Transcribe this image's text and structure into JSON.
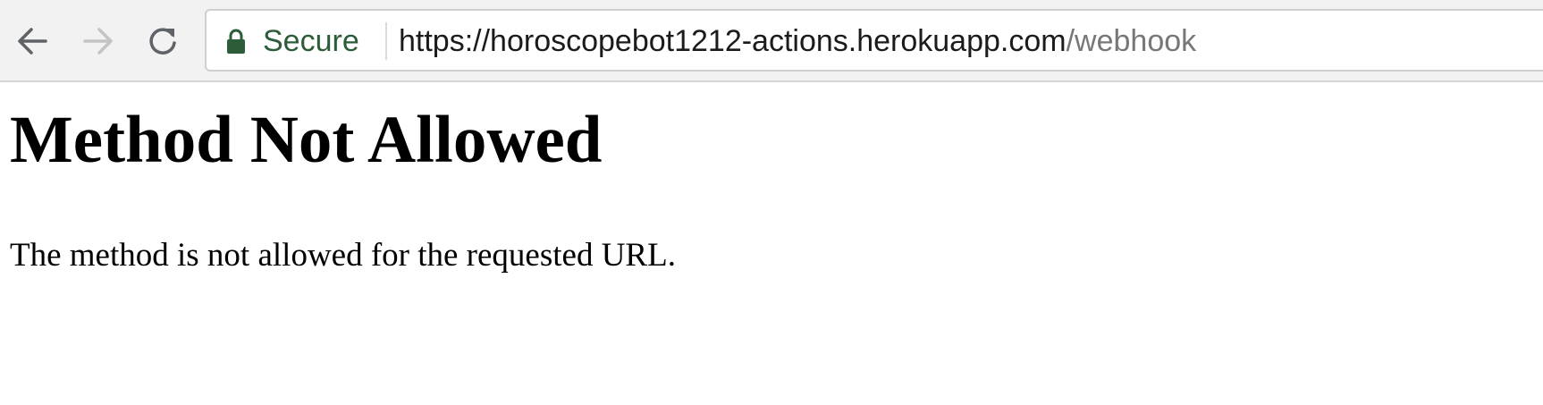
{
  "toolbar": {
    "back_icon": "arrow-left-icon",
    "forward_icon": "arrow-right-icon",
    "reload_icon": "reload-icon",
    "lock_icon": "lock-icon",
    "secure_label": "Secure",
    "url_host": "https://horoscopebot1212-actions.herokuapp.com",
    "url_path": "/webhook",
    "secure_color": "#2d5c38"
  },
  "page": {
    "title": "Method Not Allowed",
    "message": "The method is not allowed for the requested URL."
  }
}
